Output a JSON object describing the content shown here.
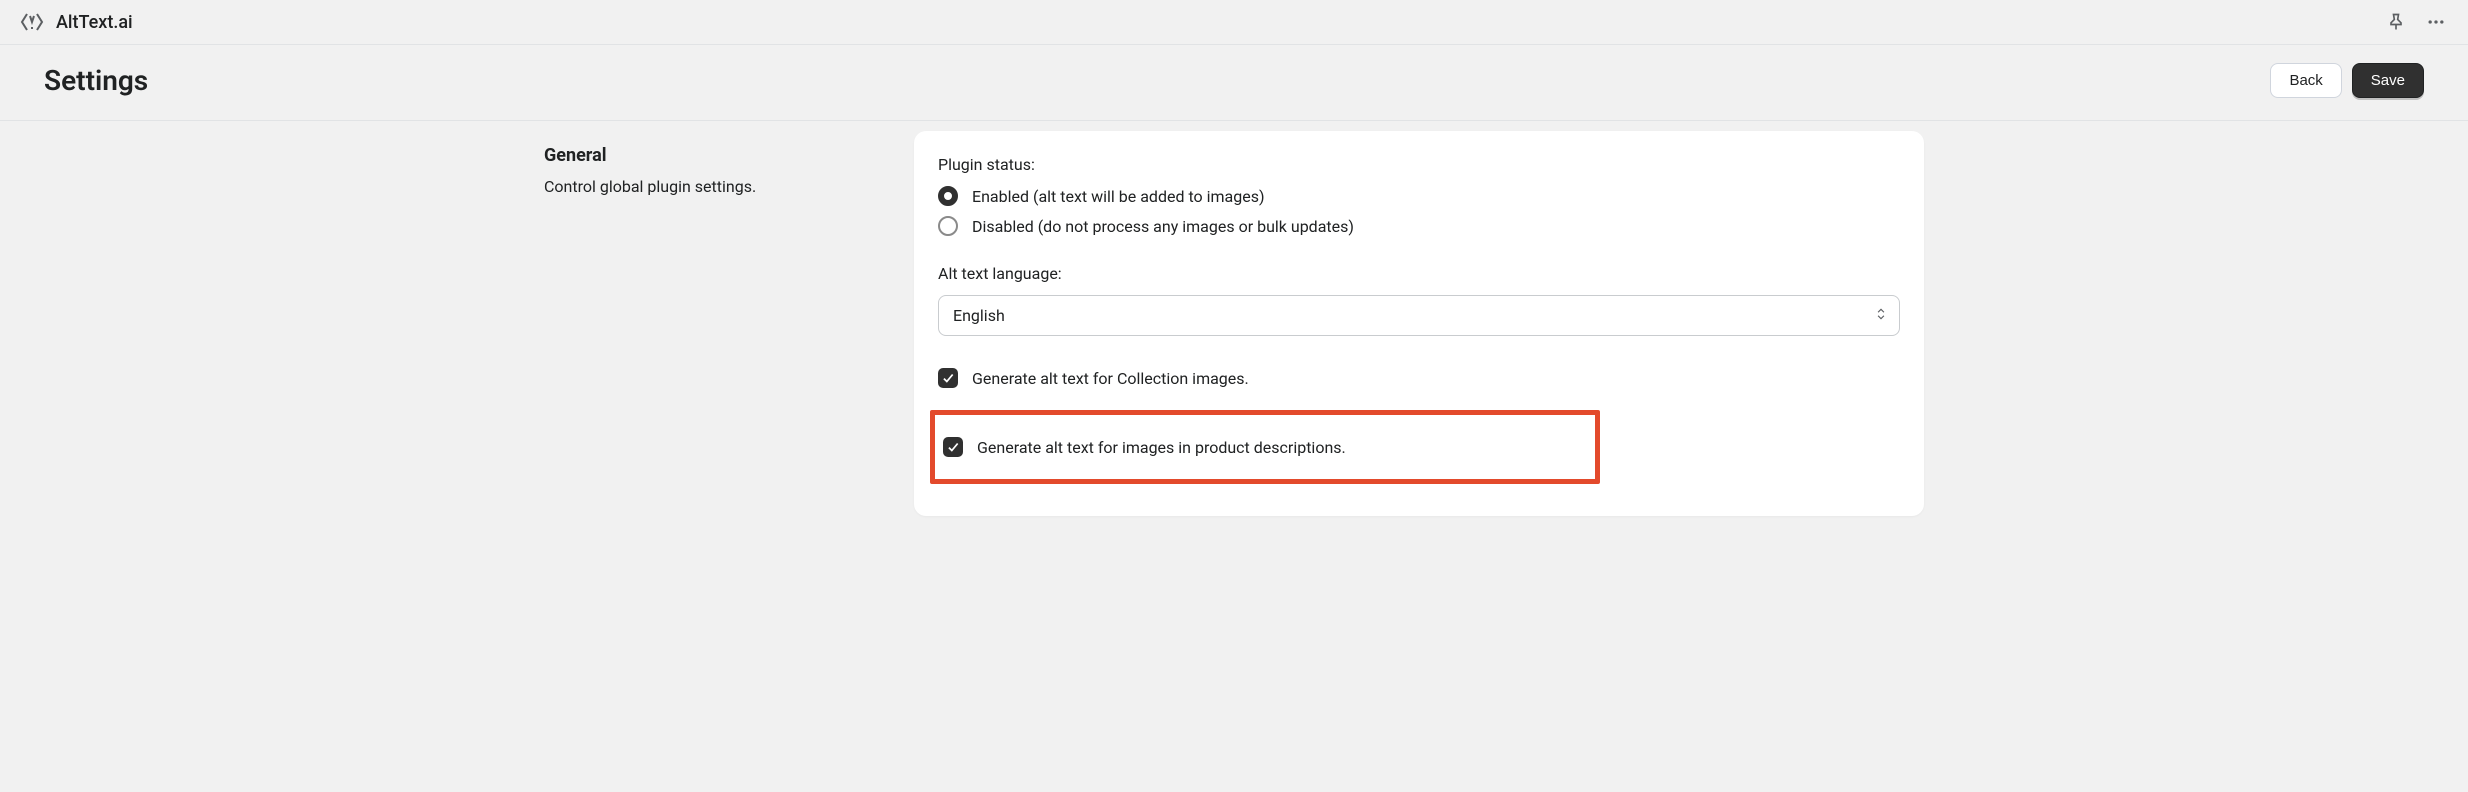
{
  "topbar": {
    "app_name": "AltText.ai"
  },
  "header": {
    "title": "Settings",
    "back_label": "Back",
    "save_label": "Save"
  },
  "sidebar": {
    "section_title": "General",
    "section_desc": "Control global plugin settings."
  },
  "card": {
    "plugin_status_label": "Plugin status:",
    "radio_enabled": "Enabled (alt text will be added to images)",
    "radio_disabled": "Disabled (do not process any images or bulk updates)",
    "alt_lang_label": "Alt text language:",
    "alt_lang_value": "English",
    "checkbox_collection": "Generate alt text for Collection images.",
    "checkbox_product_desc": "Generate alt text for images in product descriptions."
  }
}
